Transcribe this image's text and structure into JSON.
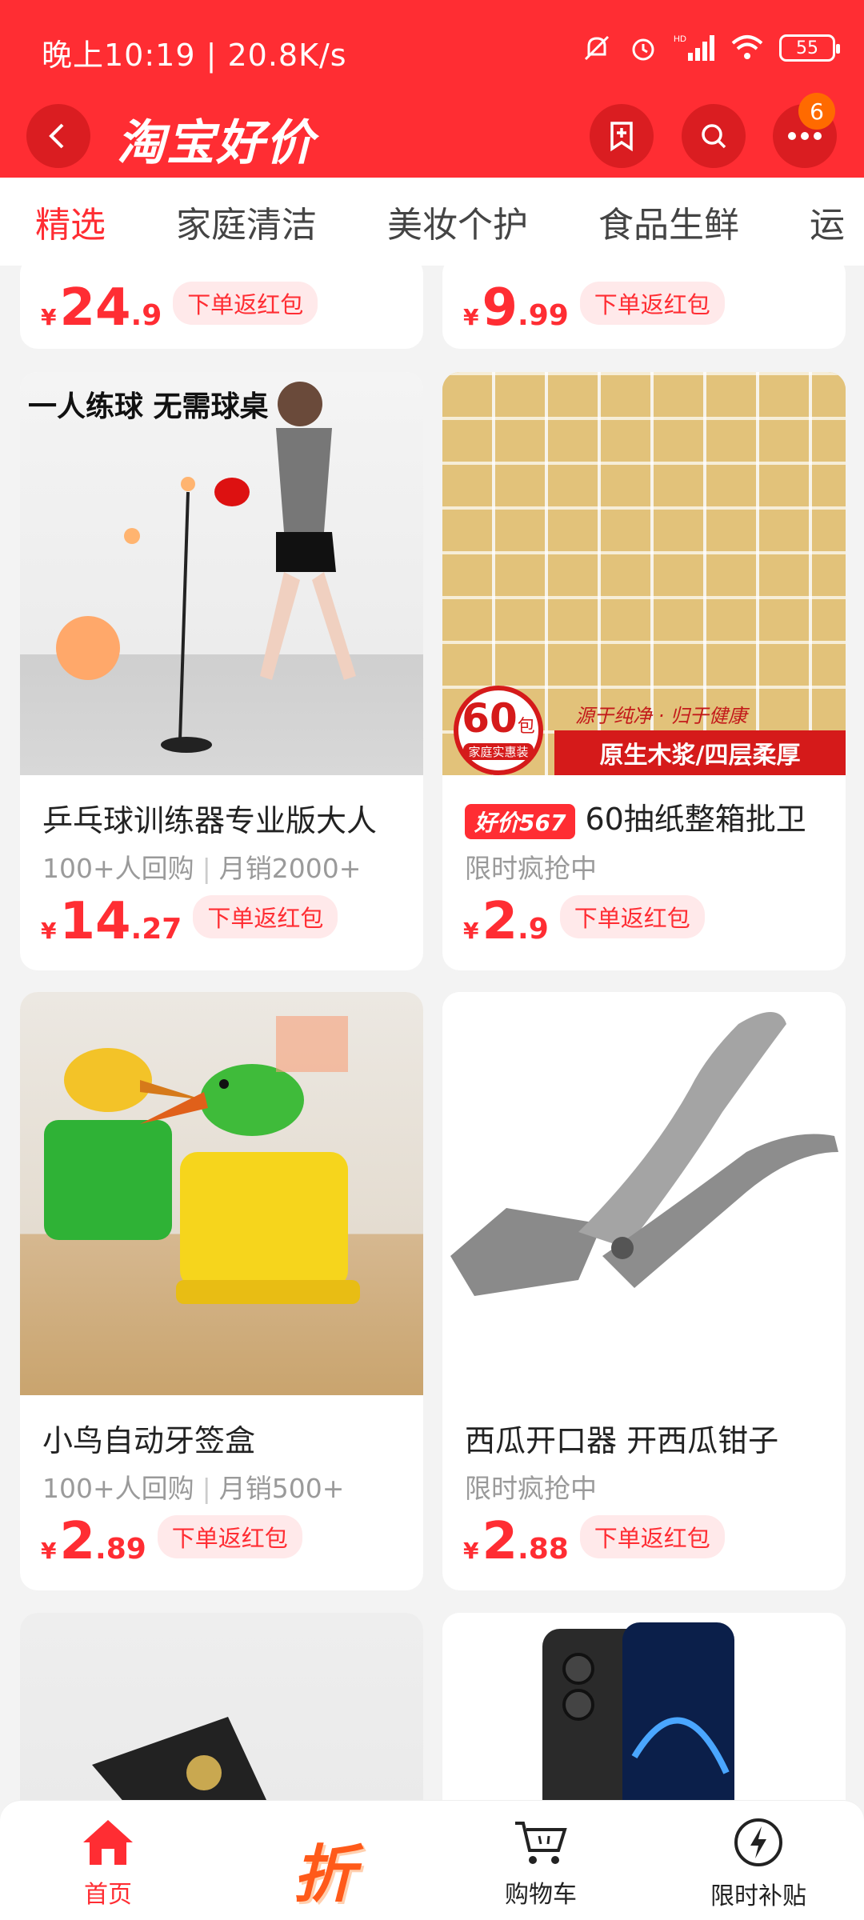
{
  "status": {
    "time": "晚上10:19 | 20.8K/s",
    "battery": "55",
    "hd": "HD"
  },
  "header": {
    "logo": "淘宝好价",
    "badge_count": "6"
  },
  "tabs": [
    "精选",
    "家庭清洁",
    "美妆个护",
    "食品生鲜",
    "运"
  ],
  "top_row": [
    {
      "price_int": "24",
      "price_dec": ".9",
      "tag": "下单返红包"
    },
    {
      "price_int": "9",
      "price_dec": ".99",
      "tag": "下单返红包"
    }
  ],
  "products": [
    {
      "title": "乒乓球训练器专业版大人",
      "sub1": "100+人回购",
      "sub2": "月销2000+",
      "price_int": "14",
      "price_dec": ".27",
      "tag": "下单返红包",
      "img_text": "一人练球  无需球桌"
    },
    {
      "badge": "好价567",
      "title": "60抽纸整箱批卫",
      "sub1": "限时疯抢中",
      "price_int": "2",
      "price_dec": ".9",
      "tag": "下单返红包",
      "img_num": "60",
      "img_unit": "包",
      "img_small": "家庭实惠装",
      "img_slogan": "源于纯净 · 归于健康",
      "img_banner": "原生木浆/四层柔厚"
    },
    {
      "title": "小鸟自动牙签盒",
      "sub1": "100+人回购",
      "sub2": "月销500+",
      "price_int": "2",
      "price_dec": ".89",
      "tag": "下单返红包"
    },
    {
      "title": "西瓜开口器 开西瓜钳子",
      "sub1": "限时疯抢中",
      "price_int": "2",
      "price_dec": ".88",
      "tag": "下单返红包"
    }
  ],
  "currency": "¥",
  "bottom_nav": [
    {
      "label": "首页",
      "icon": "home-icon"
    },
    {
      "label": "折",
      "icon": "discount-icon"
    },
    {
      "label": "购物车",
      "icon": "cart-icon"
    },
    {
      "label": "限时补贴",
      "icon": "lightning-icon"
    }
  ],
  "colors": {
    "brand": "#ff2d33",
    "accent": "#ff6a00"
  }
}
